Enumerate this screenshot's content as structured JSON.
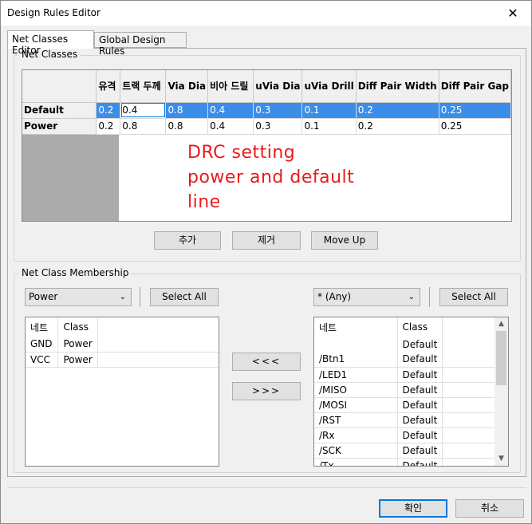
{
  "window": {
    "title": "Design Rules Editor",
    "close_glyph": "✕"
  },
  "tabs": [
    {
      "label": "Net Classes Editor",
      "active": true
    },
    {
      "label": "Global Design Rules",
      "active": false
    }
  ],
  "net_classes": {
    "group_title": "Net Classes",
    "columns": [
      "유격",
      "트랙 두께",
      "Via Dia",
      "비아 드릴",
      "uVia Dia",
      "uVia Drill",
      "Diff Pair Width",
      "Diff Pair Gap"
    ],
    "rows": [
      {
        "name": "Default",
        "values": [
          "0.2",
          "0.4",
          "0.8",
          "0.4",
          "0.3",
          "0.1",
          "0.2",
          "0.25"
        ],
        "selected": true
      },
      {
        "name": "Power",
        "values": [
          "0.2",
          "0.8",
          "0.8",
          "0.4",
          "0.3",
          "0.1",
          "0.2",
          "0.25"
        ],
        "selected": false
      }
    ],
    "annotation": "DRC setting\npower and default\nline",
    "annotation_color": "#ea1b1b",
    "buttons": {
      "add": "추가",
      "remove": "제거",
      "move_up": "Move Up"
    }
  },
  "membership": {
    "group_title": "Net Class Membership",
    "left": {
      "filter_value": "Power",
      "select_all": "Select All",
      "headers": [
        "네트",
        "Class"
      ],
      "rows": [
        {
          "net": "GND",
          "class": "Power"
        },
        {
          "net": "VCC",
          "class": "Power"
        }
      ]
    },
    "move_left_label": "<<<",
    "move_right_label": ">>>",
    "right": {
      "filter_value": "* (Any)",
      "select_all": "Select All",
      "headers": [
        "네트",
        "Class"
      ],
      "first_class": "Default",
      "rows": [
        {
          "net": "/Btn1",
          "class": "Default"
        },
        {
          "net": "/LED1",
          "class": "Default"
        },
        {
          "net": "/MISO",
          "class": "Default"
        },
        {
          "net": "/MOSI",
          "class": "Default"
        },
        {
          "net": "/RST",
          "class": "Default"
        },
        {
          "net": "/Rx",
          "class": "Default"
        },
        {
          "net": "/SCK",
          "class": "Default"
        },
        {
          "net": "/Tx",
          "class": "Default"
        }
      ]
    }
  },
  "footer": {
    "ok": "확인",
    "cancel": "취소"
  },
  "colors": {
    "selection": "#3b8ee8",
    "focus": "#0078d7"
  }
}
